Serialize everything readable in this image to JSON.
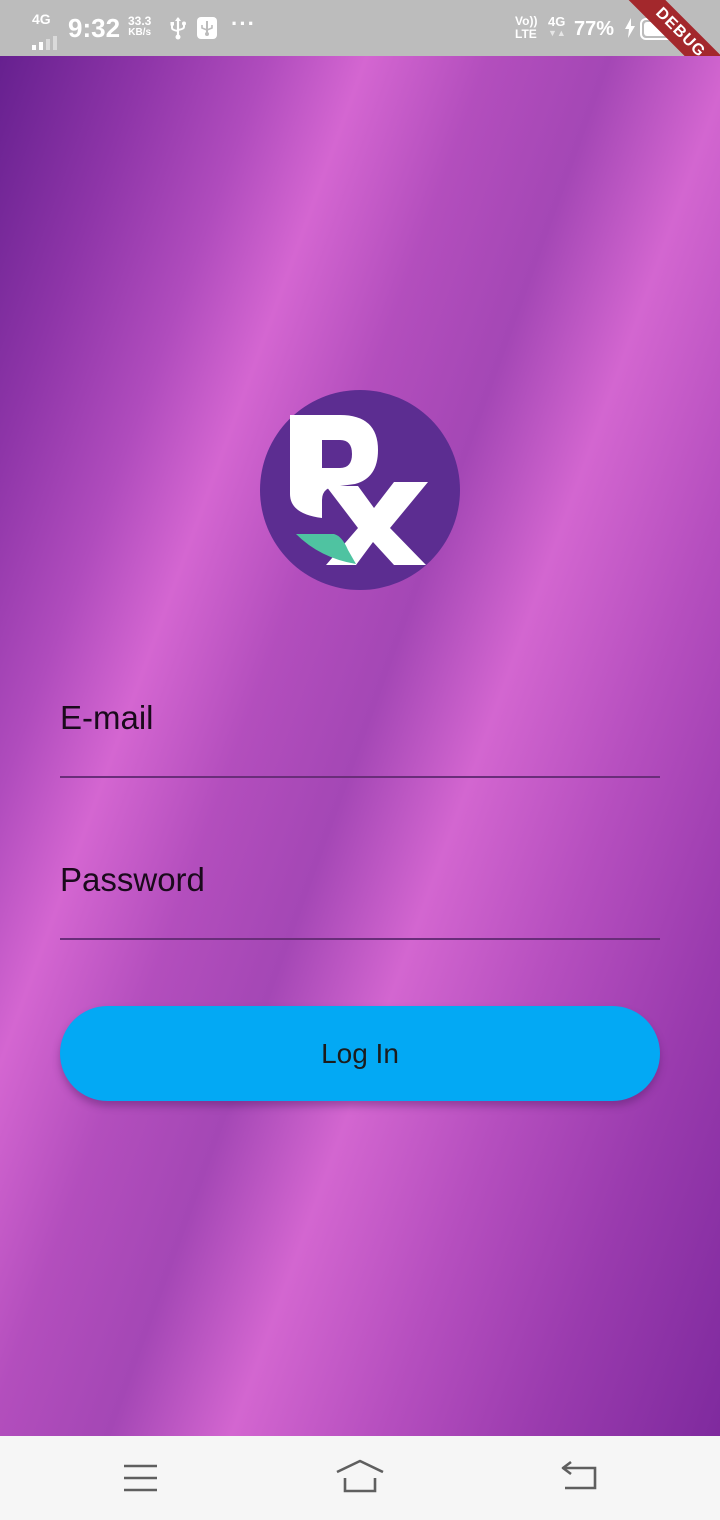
{
  "status_bar": {
    "network_left": "4G",
    "time": "9:32",
    "speed_value": "33.3",
    "speed_unit": "KB/s",
    "more_indicator": "···",
    "volte_top": "Vo))",
    "volte_bottom": "LTE",
    "network_right": "4G",
    "battery_percent": "77%",
    "icons": [
      "signal-bars-icon",
      "usb-icon",
      "usb-debug-icon",
      "charging-bolt-icon",
      "battery-icon"
    ],
    "background_color": "#bcbcbc"
  },
  "debug_banner": {
    "label": "DEBUG",
    "color": "#a3282c"
  },
  "logo": {
    "text": "Rx",
    "circle_color": "#5c2d91",
    "accent_color": "#4fc3a1"
  },
  "form": {
    "email_label": "E-mail",
    "password_label": "Password",
    "login_label": "Log In",
    "button_color": "#03a9f4"
  },
  "nav_bar": {
    "icons": [
      "menu-icon",
      "home-icon",
      "back-icon"
    ]
  }
}
